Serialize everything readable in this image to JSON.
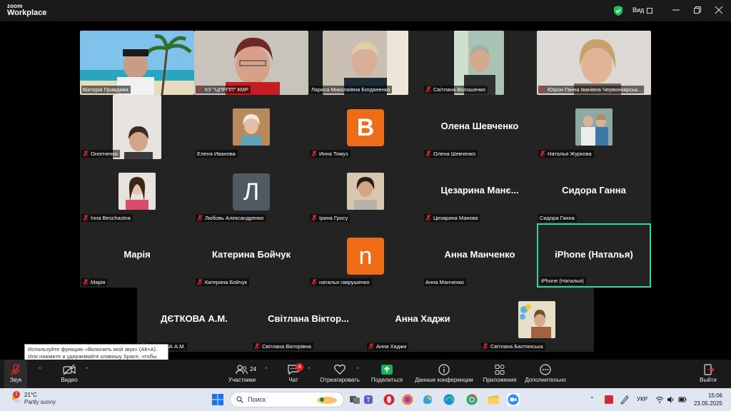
{
  "app": {
    "logo_top": "zoom",
    "logo_bottom": "Workplace",
    "view_label": "Вид"
  },
  "colors": {
    "active_speaker": "#2dd89b",
    "muted": "#e0262c",
    "tile_bg": "#232323",
    "avatar_orange": "#ee6c17",
    "avatar_gray": "#4f5a63"
  },
  "tiles": [
    {
      "label": "Вікторія Правдива",
      "muted": false
    },
    {
      "label": "КУ \"ЦПРПП\" КМР",
      "muted": true
    },
    {
      "label": "Лариса Миколаївна Богданенко",
      "muted": false
    },
    {
      "label": "Світлана Волошенко",
      "muted": true
    },
    {
      "label": "ЮІрон  Ганна Іванівна Червоноярськ...",
      "muted": true
    },
    {
      "label": "Онопченко",
      "muted": true
    },
    {
      "label": "Елена Иванова",
      "muted": false
    },
    {
      "label": "Инна Томуз",
      "muted": true,
      "avatar": "B"
    },
    {
      "label": "Олена Шевченко",
      "muted": true,
      "big": "Олена Шевченко"
    },
    {
      "label": "Наталья Журкова",
      "muted": true
    },
    {
      "label": "Inna Beschastna",
      "muted": true
    },
    {
      "label": "Любовь Александренко",
      "muted": true,
      "avatar": "Л"
    },
    {
      "label": "Ірина  Гросу",
      "muted": true
    },
    {
      "label": "Цезарина Манєва",
      "muted": true,
      "big": "Цезарина  Манє..."
    },
    {
      "label": "Сидора Ганна",
      "muted": false,
      "big": "Сидора Ганна"
    },
    {
      "label": "Марія",
      "muted": true,
      "big": "Марія"
    },
    {
      "label": "Катерина Бойчук",
      "muted": true,
      "big": "Катерина Бойчук"
    },
    {
      "label": "наталья гаврушенко",
      "muted": true,
      "avatar": "n"
    },
    {
      "label": "Анна Манченко",
      "muted": false,
      "big": "Анна Манченко"
    },
    {
      "label": "iPhone (Наталья)",
      "muted": false,
      "big": "iPhone (Наталья)",
      "active": true
    },
    {
      "label": "ДЄТКОВА А.М.",
      "muted": true,
      "big": "ДЄТКОВА А.М."
    },
    {
      "label": "Світлана Вікторівна",
      "muted": true,
      "big": "Світлана Віктор..."
    },
    {
      "label": "Анна Хаджи",
      "muted": true,
      "big": "Анна Хаджи"
    },
    {
      "label": "Світлана Балтянська",
      "muted": true
    }
  ],
  "tooltip": "Используйте функцию «Включить мой звук» (Alt+A). Или нажмите и удерживайте клавишу Space, чтобы временно включить звук.",
  "toolbar": {
    "audio": "Звук",
    "video": "Видео",
    "participants": "Участники",
    "participants_count": "24",
    "chat": "Чат",
    "chat_badge": "4",
    "react": "Отреагировать",
    "share": "Поделиться",
    "info": "Данные конференции",
    "apps": "Приложения",
    "more": "Дополнительно",
    "leave": "Выйти"
  },
  "taskbar": {
    "weather_temp": "21°C",
    "weather_text": "Partly sunny",
    "weather_badge": "1",
    "search_placeholder": "Поиск",
    "lang": "УКР",
    "time": "15:06",
    "date": "23.05.2025"
  }
}
